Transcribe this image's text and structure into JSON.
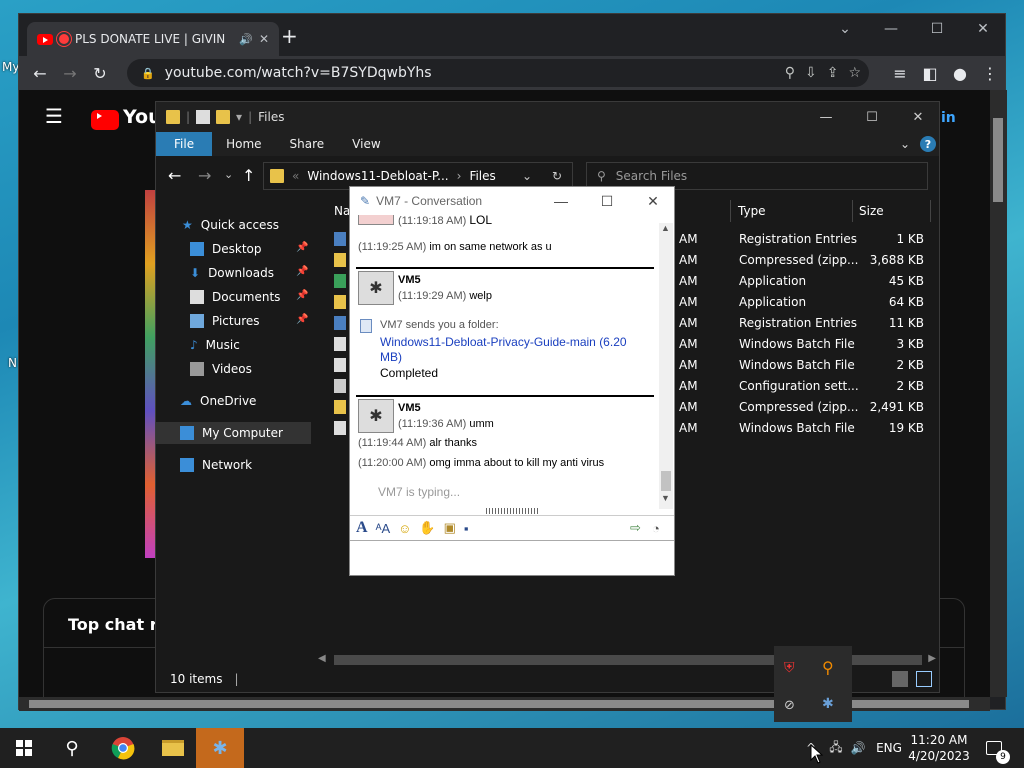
{
  "desktop": {
    "labels": [
      "My",
      "N"
    ]
  },
  "browser": {
    "tab_title": "PLS DONATE LIVE | GIVIN",
    "tab_audio": "🔊",
    "tab_close": "✕",
    "new_tab": "+",
    "url": "youtube.com/watch?v=B7SYDqwbYhs",
    "win_min": "—",
    "win_max": "☐",
    "win_close": "✕"
  },
  "youtube": {
    "logo_text": "YouTu",
    "signin_partial": "in",
    "chat_header": "Top chat rep"
  },
  "explorer": {
    "title": "Files",
    "ribbon_tabs": [
      "File",
      "Home",
      "Share",
      "View"
    ],
    "breadcrumb": [
      "Windows11-Debloat-P...",
      "Files"
    ],
    "search_placeholder": "Search Files",
    "nav": {
      "quick_access": "Quick access",
      "desktop": "Desktop",
      "downloads": "Downloads",
      "documents": "Documents",
      "pictures": "Pictures",
      "music": "Music",
      "videos": "Videos",
      "onedrive": "OneDrive",
      "my_computer": "My Computer",
      "network": "Network"
    },
    "columns": {
      "name": "Name",
      "type": "Type",
      "size": "Size"
    },
    "rows": [
      {
        "time": "AM",
        "type": "Registration Entries",
        "size": "1 KB"
      },
      {
        "time": "AM",
        "type": "Compressed (zipp...",
        "size": "3,688 KB"
      },
      {
        "time": "AM",
        "type": "Application",
        "size": "45 KB"
      },
      {
        "time": "AM",
        "type": "Application",
        "size": "64 KB"
      },
      {
        "time": "AM",
        "type": "Registration Entries",
        "size": "11 KB"
      },
      {
        "time": "AM",
        "type": "Windows Batch File",
        "size": "3 KB"
      },
      {
        "time": "AM",
        "type": "Windows Batch File",
        "size": "2 KB"
      },
      {
        "time": "AM",
        "type": "Configuration sett...",
        "size": "2 KB"
      },
      {
        "time": "AM",
        "type": "Compressed (zipp...",
        "size": "2,491 KB"
      },
      {
        "time": "AM",
        "type": "Windows Batch File",
        "size": "19 KB"
      }
    ],
    "status": "10 items"
  },
  "im": {
    "title": "VM7 - Conversation",
    "msgs": {
      "m1_ts": "(11:19:18 AM)",
      "m1": "LOL",
      "m2_ts": "(11:19:25 AM)",
      "m2": "im on same network as u",
      "vm5_a": "VM5",
      "m3_ts": "(11:19:29 AM)",
      "m3": "welp",
      "folder_notice": "VM7 sends you a folder:",
      "folder_link": "Windows11-Debloat-Privacy-Guide-main (6.20 MB)",
      "completed": "Completed",
      "vm5_b": "VM5",
      "m4_ts": "(11:19:36 AM)",
      "m4": "umm",
      "m5_ts": "(11:19:44 AM)",
      "m5": "alr thanks",
      "m6_ts": "(11:20:00 AM)",
      "m6": "omg imma about to kill my anti virus",
      "typing": "VM7 is typing..."
    }
  },
  "taskbar": {
    "time": "11:20 AM",
    "date": "4/20/2023",
    "lang": "ENG",
    "notifications": "9"
  }
}
